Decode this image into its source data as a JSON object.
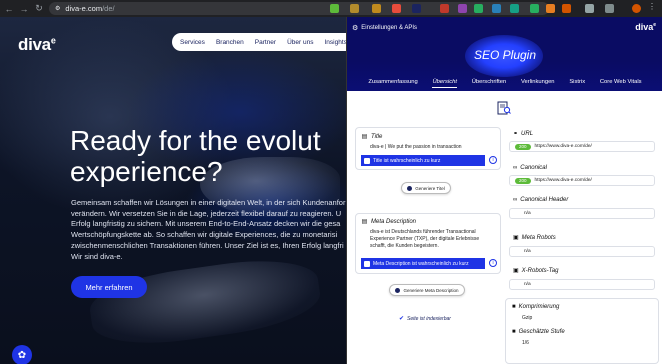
{
  "browser": {
    "url_host": "diva-e.com",
    "url_path": "/de/"
  },
  "site": {
    "logo": "diva",
    "logo_sup": "e",
    "nav": [
      "Services",
      "Branchen",
      "Partner",
      "Über uns",
      "Insights"
    ],
    "hero_line1": "Ready for the evolut",
    "hero_line2": "experience?",
    "intro_lines": [
      "Gemeinsam schaffen wir Lösungen in einer digitalen Welt, in der sich Kundenanfor",
      "verändern. Wir versetzen Sie in die Lage, jederzeit flexibel darauf zu reagieren. U",
      "Erfolg langfristig zu sichern. Mit unserem End-to-End-Ansatz decken wir die gesa",
      "Wertschöpfungskette ab. So schaffen wir digitale Experiences, die zu monetarisi",
      "zwischenmenschlichen Transaktionen führen. Unser Ziel ist es, Ihren Erfolg langfri",
      "Wir sind diva-e."
    ],
    "cta": "Mehr erfahren"
  },
  "plugin": {
    "settings_label": "Einstellungen & APIs",
    "brand": "diva",
    "brand_sup": "e",
    "title": "SEO Plugin",
    "tabs": [
      "Zusammenfassung",
      "Übersicht",
      "Überschriften",
      "Verlinkungen",
      "Sistrix",
      "Core Web Vitals"
    ],
    "active_tab": "Übersicht",
    "title_section": {
      "label": "Title",
      "value": "diva-e | We put the passion in transaction",
      "warning": "Title ist wahrscheinlich zu kurz",
      "generate": "Generiere Titel"
    },
    "meta_section": {
      "label": "Meta Description",
      "value_lines": [
        "diva-e ist Deutschlands führender Transactional",
        "Experience Partner (TXP), der digitale Erlebnisse",
        "schafft, die Kunden begeistern."
      ],
      "warning": "Meta Description ist wahrscheinlich zu kurz",
      "generate": "Generiere Meta Description"
    },
    "indexable": "Seite ist indexierbar",
    "url": {
      "label": "URL",
      "badge": "200",
      "value": "https://www.diva-e.com/de/"
    },
    "canonical": {
      "label": "Canonical",
      "badge": "200",
      "value": "https://www.diva-e.com/de/"
    },
    "canonical_header": {
      "label": "Canonical Header",
      "value": "n/a"
    },
    "meta_robots": {
      "label": "Meta Robots",
      "value": "n/a"
    },
    "x_robots": {
      "label": "X-Robots-Tag",
      "value": "n/a"
    },
    "compression": {
      "label": "Komprimierung",
      "value": "Gzip"
    },
    "speed": {
      "label": "Geschätzte Stufe",
      "value": "1/6"
    }
  }
}
